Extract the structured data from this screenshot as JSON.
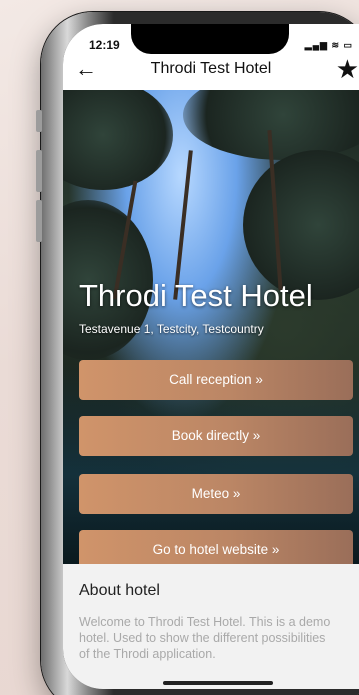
{
  "status": {
    "time": "12:19",
    "icons": "▂▄▆ ≋ ▭"
  },
  "nav": {
    "back_icon": "←",
    "title": "Throdi Test Hotel",
    "favorite_icon": "★"
  },
  "hotel": {
    "name": "Throdi Test Hotel",
    "address": "Testavenue 1, Testcity, Testcountry"
  },
  "actions": [
    {
      "label": "Call reception »"
    },
    {
      "label": "Book directly »"
    },
    {
      "label": "Meteo »"
    },
    {
      "label": "Go to hotel website »"
    }
  ],
  "about": {
    "title": "About hotel",
    "text": "Welcome to Throdi Test Hotel. This is a demo hotel. Used to show the different possibilities of the Throdi application."
  },
  "colors": {
    "accent_start": "#d0946a",
    "accent_end": "#9a6e59",
    "about_bg": "#f2f2f2"
  }
}
